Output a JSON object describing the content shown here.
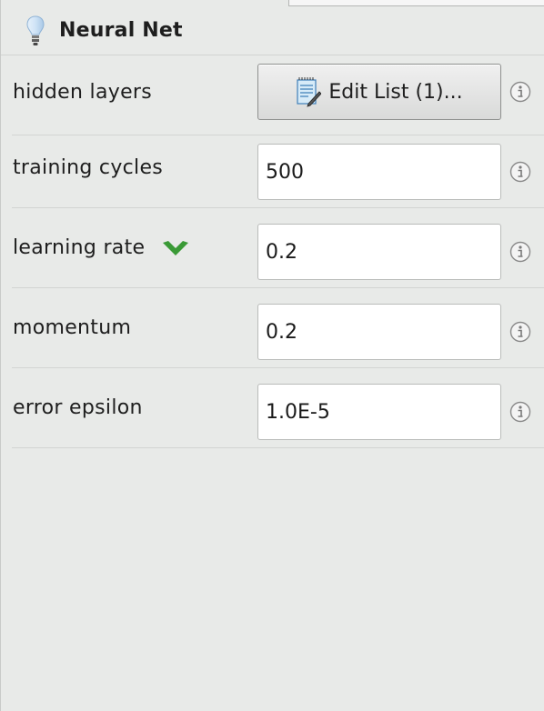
{
  "panel": {
    "title": "Neural Net",
    "title_icon": "lightbulb-icon"
  },
  "rows": [
    {
      "label": "hidden layers",
      "control": "button",
      "button_label": "Edit List (1)...",
      "button_icon": "notepad-icon"
    },
    {
      "label": "training cycles",
      "control": "input",
      "value": "500"
    },
    {
      "label": "learning rate",
      "control": "input",
      "value": "0.2",
      "expand_icon": "chevron-down-icon",
      "expand_icon_color": "#3a9a36"
    },
    {
      "label": "momentum",
      "control": "input",
      "value": "0.2"
    },
    {
      "label": "error epsilon",
      "control": "input",
      "value": "1.0E-5"
    }
  ],
  "help_icon": "info-icon",
  "colors": {
    "panel_background": "#e8eae8",
    "divider": "#d2d4d2",
    "field_background": "#ffffff",
    "accent_green": "#3a9a36"
  }
}
